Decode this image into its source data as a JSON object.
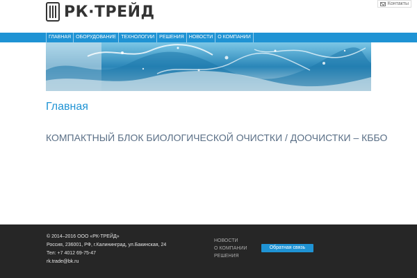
{
  "header": {
    "logo_text": "РК·ТРЕЙД",
    "contacts_label": "Контакты"
  },
  "nav": {
    "items": [
      {
        "label": "ГЛАВНАЯ"
      },
      {
        "label": "ОБОРУДОВАНИЕ"
      },
      {
        "label": "ТЕХНОЛОГИИ"
      },
      {
        "label": "РЕШЕНИЯ"
      },
      {
        "label": "НОВОСТИ"
      },
      {
        "label": "О КОМПАНИИ"
      }
    ]
  },
  "main": {
    "title": "Главная",
    "subtitle": "КОМПАКТНЫЙ БЛОК БИОЛОГИЧЕСКОЙ ОЧИСТКИ / ДООЧИСТКИ – КББО"
  },
  "footer": {
    "copyright": "© 2014–2016 ООО «РК-ТРЕЙД»",
    "address": "Россия, 236001, РФ, г.Калининград, ул.Бакинская, 24",
    "phone": "Тел: +7 4012 69-75-47",
    "email": "rk.trade@bk.ru",
    "links": [
      {
        "label": "НОВОСТИ"
      },
      {
        "label": "О КОМПАНИИ"
      },
      {
        "label": "РЕШЕНИЯ"
      }
    ],
    "feedback_label": "Обратная связь"
  },
  "colors": {
    "accent": "#1f93d4",
    "footer_bg": "#262626",
    "subtitle": "#5a6f86"
  },
  "icons": {
    "contacts": "envelope-icon",
    "logo": "logo-mark-icon"
  }
}
